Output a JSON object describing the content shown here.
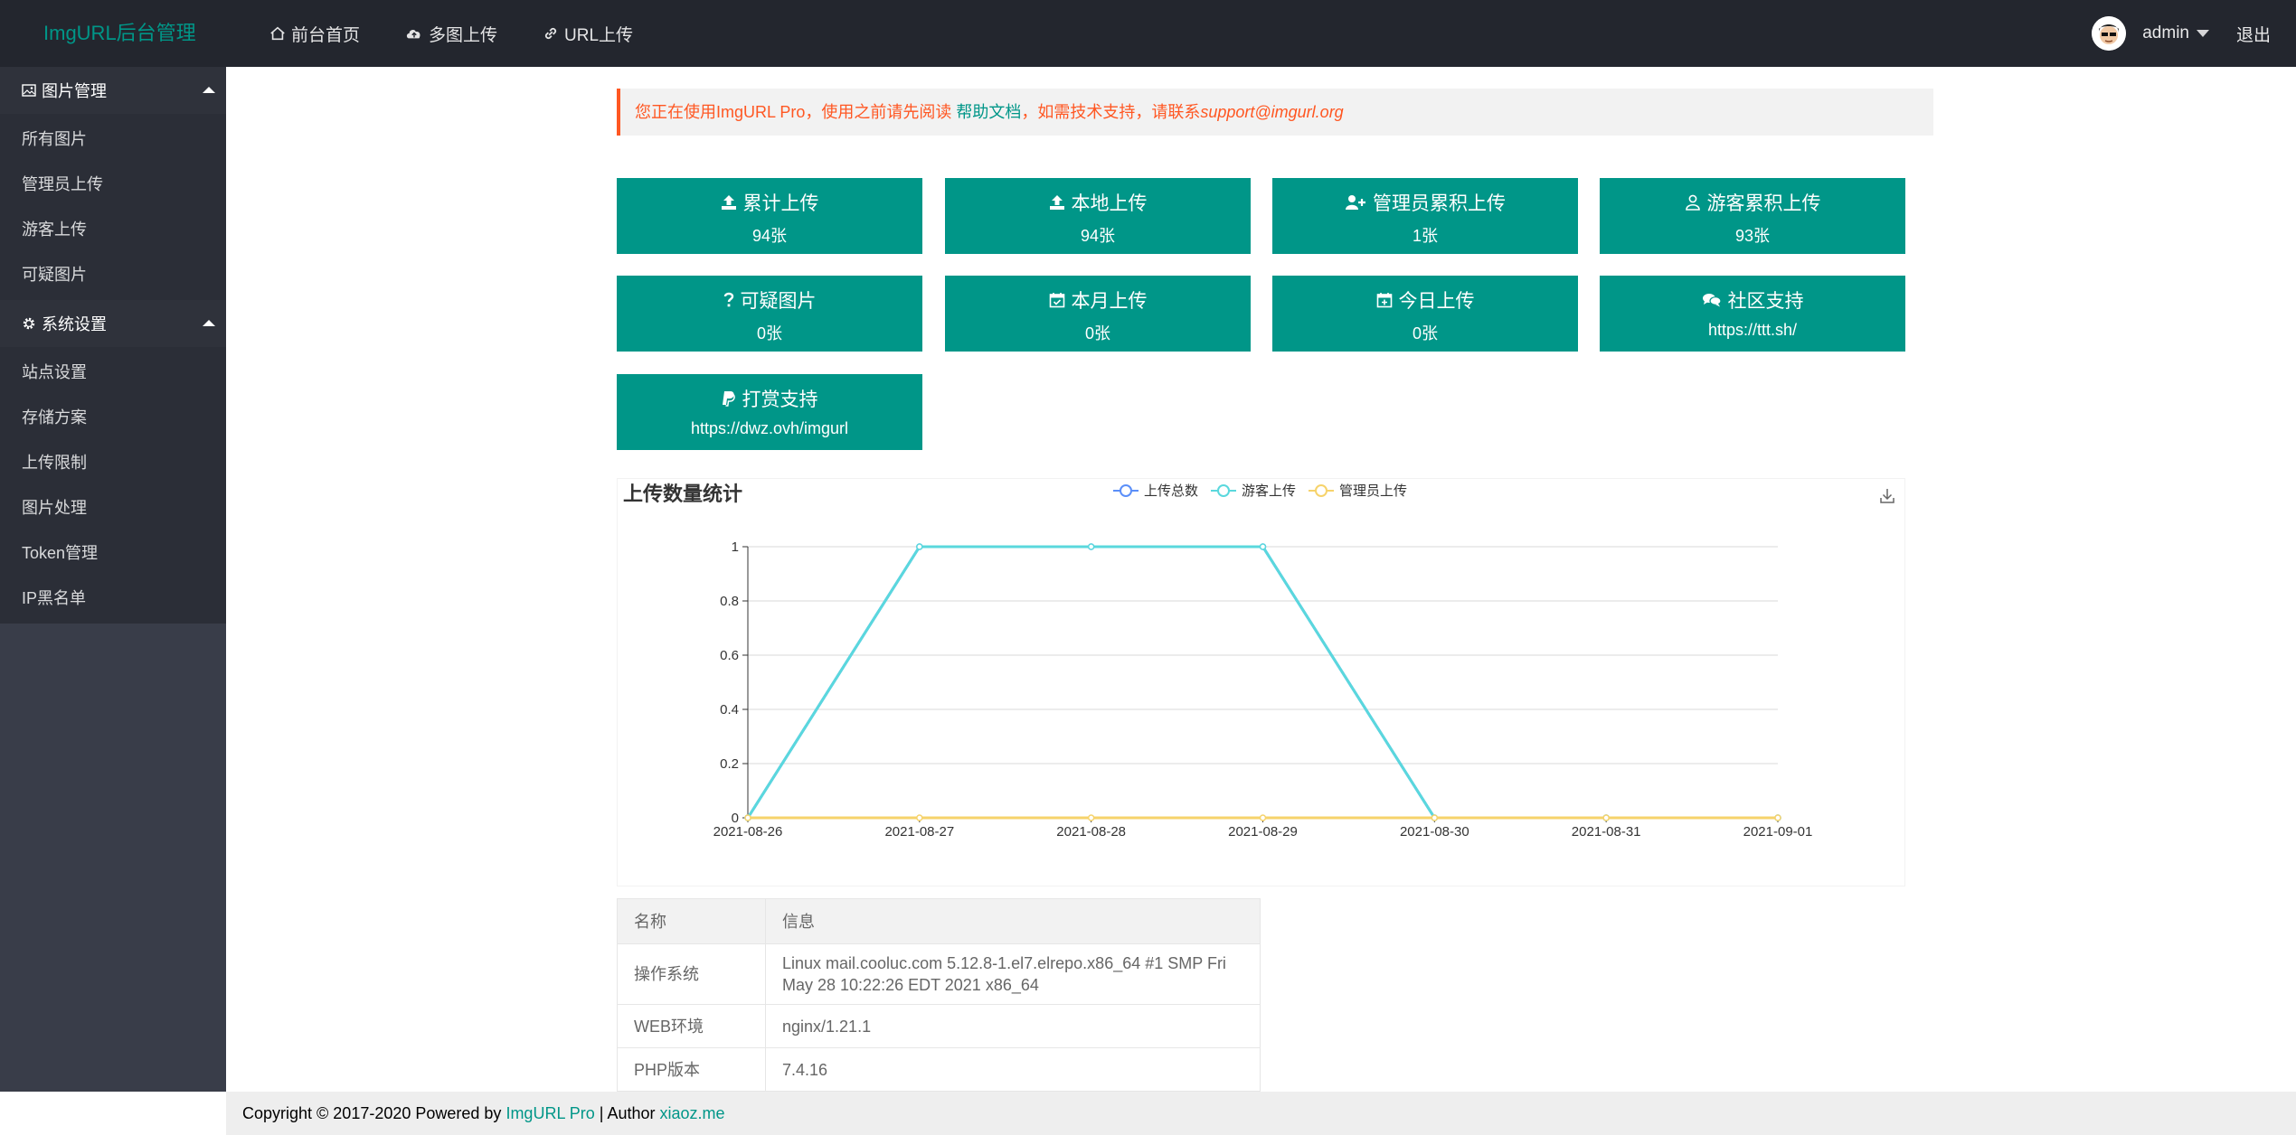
{
  "header": {
    "logo": "ImgURL后台管理",
    "nav": [
      {
        "label": "前台首页",
        "icon": "home-icon"
      },
      {
        "label": "多图上传",
        "icon": "cloud-upload-icon"
      },
      {
        "label": "URL上传",
        "icon": "link-icon"
      }
    ],
    "user": "admin",
    "logout": "退出"
  },
  "sidebar": {
    "groups": [
      {
        "title": "图片管理",
        "icon": "image-icon",
        "items": [
          "所有图片",
          "管理员上传",
          "游客上传",
          "可疑图片"
        ]
      },
      {
        "title": "系统设置",
        "icon": "gear-icon",
        "items": [
          "站点设置",
          "存储方案",
          "上传限制",
          "图片处理",
          "Token管理",
          "IP黑名单"
        ]
      }
    ]
  },
  "notice": {
    "prefix": "您正在使用ImgURL Pro，使用之前请先阅读 ",
    "link": "帮助文档",
    "middle": "，如需技术支持，请联系",
    "email": "support@imgurl.org"
  },
  "stats": [
    {
      "title": "累计上传",
      "value": "94张",
      "icon": "upload-icon"
    },
    {
      "title": "本地上传",
      "value": "94张",
      "icon": "upload-icon"
    },
    {
      "title": "管理员累积上传",
      "value": "1张",
      "icon": "user-plus-icon"
    },
    {
      "title": "游客累积上传",
      "value": "93张",
      "icon": "user-icon"
    },
    {
      "title": "可疑图片",
      "value": "0张",
      "icon": "question-icon"
    },
    {
      "title": "本月上传",
      "value": "0张",
      "icon": "calendar-check-icon"
    },
    {
      "title": "今日上传",
      "value": "0张",
      "icon": "calendar-plus-icon"
    },
    {
      "title": "社区支持",
      "value": "https://ttt.sh/",
      "icon": "comments-icon"
    },
    {
      "title": "打赏支持",
      "value": "https://dwz.ovh/imgurl",
      "icon": "paypal-icon"
    }
  ],
  "chart_data": {
    "type": "line",
    "title": "上传数量统计",
    "categories": [
      "2021-08-26",
      "2021-08-27",
      "2021-08-28",
      "2021-08-29",
      "2021-08-30",
      "2021-08-31",
      "2021-09-01"
    ],
    "series": [
      {
        "name": "上传总数",
        "color": "#5b8ff9",
        "values": [
          0,
          1,
          1,
          1,
          0,
          0,
          0
        ]
      },
      {
        "name": "游客上传",
        "color": "#5ad8dd",
        "values": [
          0,
          1,
          1,
          1,
          0,
          0,
          0
        ]
      },
      {
        "name": "管理员上传",
        "color": "#f6d36b",
        "values": [
          0,
          0,
          0,
          0,
          0,
          0,
          0
        ]
      }
    ],
    "ylim": [
      0,
      1
    ],
    "yticks": [
      "0",
      "0.2",
      "0.4",
      "0.6",
      "0.8",
      "1"
    ],
    "grid": true,
    "legend": "top-center",
    "xlabel": "",
    "ylabel": ""
  },
  "info_table": {
    "headers": [
      "名称",
      "信息"
    ],
    "rows": [
      [
        "操作系统",
        "Linux mail.cooluc.com 5.12.8-1.el7.elrepo.x86_64 #1 SMP Fri May 28 10:22:26 EDT 2021 x86_64"
      ],
      [
        "WEB环境",
        "nginx/1.21.1"
      ],
      [
        "PHP版本",
        "7.4.16"
      ]
    ]
  },
  "footer": {
    "prefix": "Copyright © 2017-2020 Powered by ",
    "powered": "ImgURL Pro",
    "sep": " | Author ",
    "author": "xiaoz.me"
  }
}
